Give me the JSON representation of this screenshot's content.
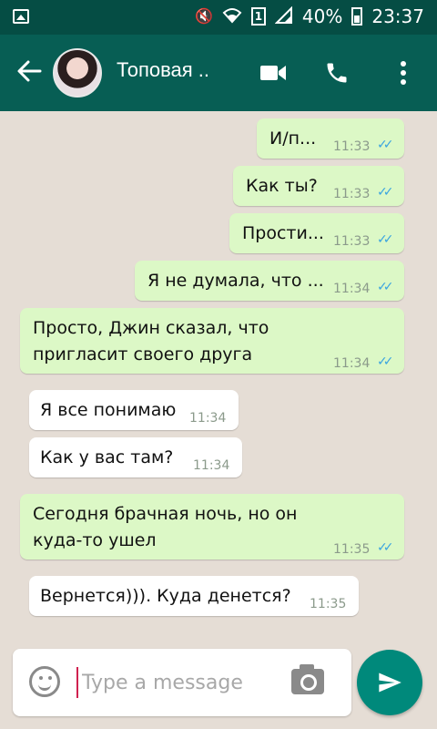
{
  "status_bar": {
    "battery": "40%",
    "time": "23:37",
    "sim": "1"
  },
  "header": {
    "contact_name": "Топовая ..",
    "icons": [
      "back-arrow-icon",
      "video-call-icon",
      "phone-icon",
      "more-vert-icon"
    ]
  },
  "colors": {
    "header": "#075e54",
    "status_bar": "#054d44",
    "outgoing": "#dcf8c6",
    "incoming": "#ffffff",
    "ticks": "#3aa4e0",
    "send_button": "#00897b"
  },
  "messages": [
    {
      "direction": "out",
      "text": "И/п...",
      "time": "11:33",
      "status": "read"
    },
    {
      "direction": "out",
      "text": "Как ты?",
      "time": "11:33",
      "status": "read"
    },
    {
      "direction": "out",
      "text": "Прости...",
      "time": "11:33",
      "status": "read"
    },
    {
      "direction": "out",
      "text": "Я не думала, что ...",
      "time": "11:34",
      "status": "read"
    },
    {
      "direction": "out",
      "text_line1": "Просто, Джин сказал, что",
      "text_line2": "пригласит своего друга",
      "time": "11:34",
      "status": "read"
    },
    {
      "direction": "in",
      "text": "Я все понимаю",
      "time": "11:34"
    },
    {
      "direction": "in",
      "text": "Как у вас там?",
      "time": "11:34"
    },
    {
      "direction": "out",
      "text_line1": "Сегодня брачная ночь, но он",
      "text_line2": "куда-то ушел",
      "time": "11:35",
      "status": "read"
    },
    {
      "direction": "in",
      "text": "Вернется))). Куда денется?",
      "time": "11:35"
    }
  ],
  "composer": {
    "placeholder": "Type a message",
    "value": ""
  }
}
